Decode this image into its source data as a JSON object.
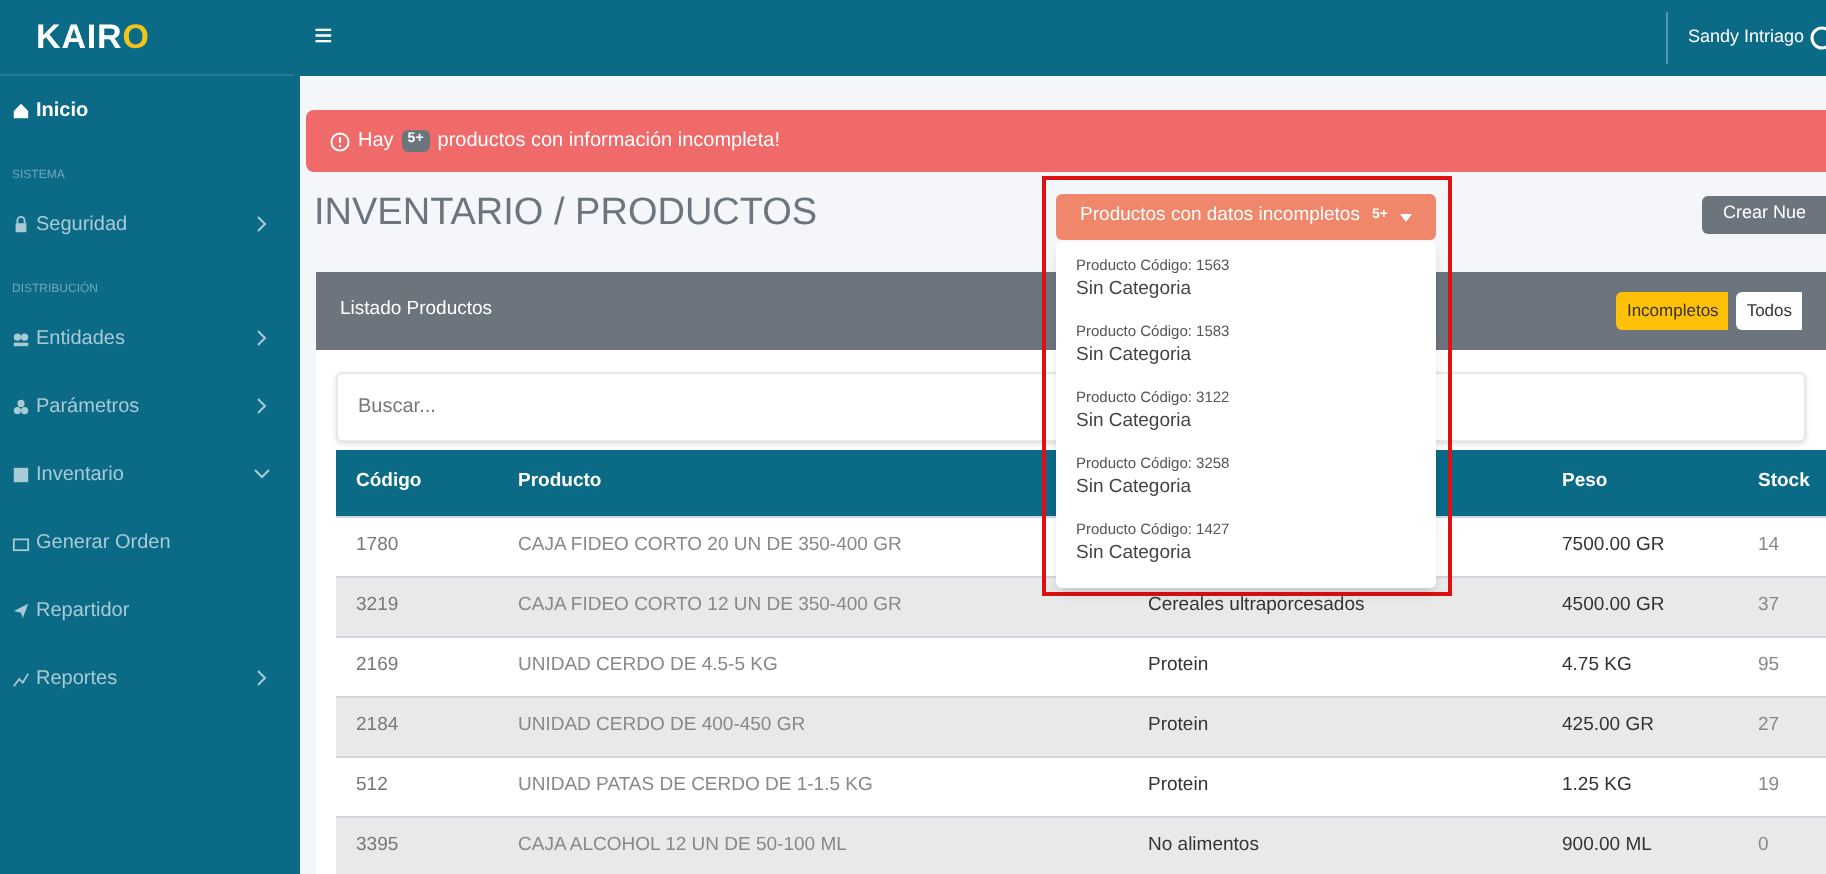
{
  "logo": {
    "main": "KAIR",
    "accent": "O"
  },
  "topbar": {
    "menu_glyph": "≡",
    "user": "Sandy Intriago"
  },
  "sidebar": {
    "items": [
      {
        "kind": "item",
        "label": "Inicio",
        "selected": true,
        "expandable": false
      },
      {
        "kind": "section",
        "label": "SISTEMA"
      },
      {
        "kind": "item",
        "label": "Seguridad",
        "selected": false,
        "expandable": true,
        "expanded": false
      },
      {
        "kind": "section",
        "label": "DISTRIBUCIÓN"
      },
      {
        "kind": "item",
        "label": "Entidades",
        "selected": false,
        "expandable": true,
        "expanded": false
      },
      {
        "kind": "item",
        "label": "Parámetros",
        "selected": false,
        "expandable": true,
        "expanded": false
      },
      {
        "kind": "item",
        "label": "Inventario",
        "selected": false,
        "expandable": true,
        "expanded": true
      },
      {
        "kind": "item",
        "label": "Generar Orden",
        "selected": false,
        "expandable": false
      },
      {
        "kind": "item",
        "label": "Repartidor",
        "selected": false,
        "expandable": false
      },
      {
        "kind": "item",
        "label": "Reportes",
        "selected": false,
        "expandable": true,
        "expanded": false
      }
    ]
  },
  "alert": {
    "before": "Hay",
    "badge": "5+",
    "after": "productos con información incompleta!"
  },
  "page_title": "INVENTARIO / PRODUCTOS",
  "dropdown": {
    "label": "Productos con datos incompletos",
    "badge": "5+",
    "expanded": true,
    "items": [
      {
        "code": "Producto Código: 1563",
        "category": "Sin Categoria"
      },
      {
        "code": "Producto Código: 1583",
        "category": "Sin Categoria"
      },
      {
        "code": "Producto Código: 3122",
        "category": "Sin Categoria"
      },
      {
        "code": "Producto Código: 3258",
        "category": "Sin Categoria"
      },
      {
        "code": "Producto Código: 1427",
        "category": "Sin Categoria"
      }
    ]
  },
  "create_button": "Crear Nue",
  "card": {
    "title": "Listado Productos",
    "filters": [
      {
        "label": "Incompletos",
        "selected": true
      },
      {
        "label": "Todos",
        "selected": false
      }
    ]
  },
  "search": {
    "placeholder": "Buscar..."
  },
  "table": {
    "columns": [
      "Código",
      "Producto",
      "Peso",
      "Stock"
    ],
    "rows": [
      {
        "code": "1780",
        "product": "CAJA FIDEO CORTO 20 UN DE 350-400 GR",
        "weight": "7500.00 GR",
        "stock": "14"
      },
      {
        "code": "3219",
        "product": "CAJA FIDEO CORTO 12 UN DE 350-400 GR",
        "category": "Cereales ultraporcesados",
        "weight": "4500.00 GR",
        "stock": "37"
      },
      {
        "code": "2169",
        "product": "UNIDAD CERDO DE 4.5-5 KG",
        "category": "Protein",
        "weight": "4.75 KG",
        "stock": "95"
      },
      {
        "code": "2184",
        "product": "UNIDAD CERDO DE 400-450 GR",
        "category": "Protein",
        "weight": "425.00 GR",
        "stock": "27"
      },
      {
        "code": "512",
        "product": "UNIDAD PATAS DE CERDO DE 1-1.5 KG",
        "category": "Protein",
        "weight": "1.25 KG",
        "stock": "19"
      },
      {
        "code": "3395",
        "product": "CAJA ALCOHOL 12 UN DE 50-100 ML",
        "category": "No alimentos",
        "weight": "900.00 ML",
        "stock": "0"
      }
    ]
  }
}
